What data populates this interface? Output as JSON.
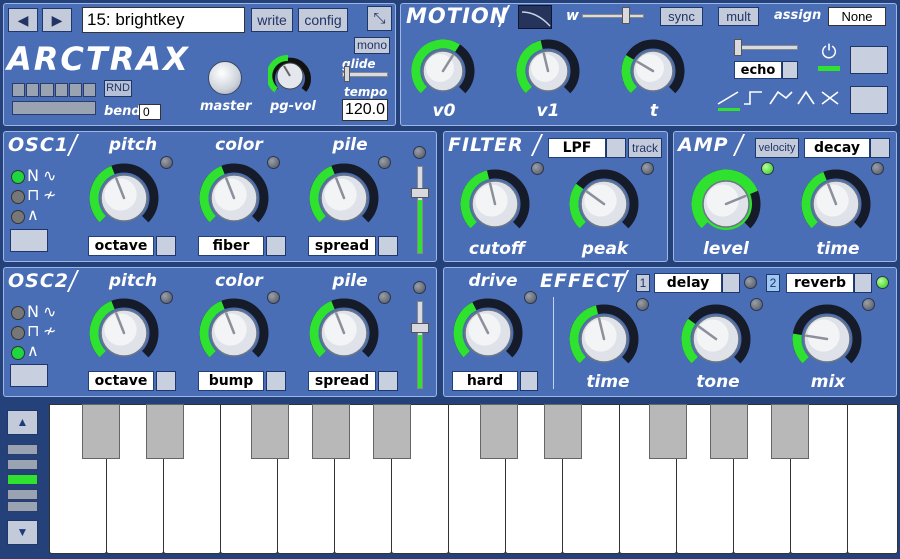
{
  "header": {
    "prev_label": "◀",
    "next_label": "▶",
    "preset_value": "15: brightkey",
    "write_label": "write",
    "config_label": "config",
    "collapse_icon": "collapse-icon",
    "logo": "ARCTRAX",
    "mono_label": "mono",
    "rnd_label": "RND",
    "bend_label": "bend",
    "bend_value": "0",
    "master_label": "master",
    "pgvol_label": "pg-vol",
    "glide_label": "glide",
    "tempo_label": "tempo",
    "tempo_value": "120.0"
  },
  "motion": {
    "title": "MOTION",
    "w_label": "w",
    "sync_label": "sync",
    "mult_label": "mult",
    "assign_label": "assign",
    "assign_value": "None",
    "knobs": [
      {
        "label": "v0",
        "value": 0.62
      },
      {
        "label": "v1",
        "value": 0.45
      },
      {
        "label": "t",
        "value": 0.28
      }
    ],
    "echo_label": "echo",
    "power_icon": "power-icon"
  },
  "osc1": {
    "title": "OSC1",
    "knobs": [
      {
        "label": "pitch",
        "sub": "octave",
        "value": 0.42
      },
      {
        "label": "color",
        "sub": "fiber",
        "value": 0.42
      },
      {
        "label": "pile",
        "sub": "spread",
        "value": 0.42
      }
    ]
  },
  "osc2": {
    "title": "OSC2",
    "knobs": [
      {
        "label": "pitch",
        "sub": "octave",
        "value": 0.42
      },
      {
        "label": "color",
        "sub": "bump",
        "value": 0.42
      },
      {
        "label": "pile",
        "sub": "spread",
        "value": 0.42
      }
    ]
  },
  "filter": {
    "title": "FILTER",
    "type_value": "LPF",
    "track_label": "track",
    "knobs": [
      {
        "label": "cutoff",
        "value": 0.45
      },
      {
        "label": "peak",
        "value": 0.3
      }
    ]
  },
  "amp": {
    "title": "AMP",
    "velocity_label": "velocity",
    "env_value": "decay",
    "knobs": [
      {
        "label": "level",
        "value": 0.75
      },
      {
        "label": "time",
        "value": 0.42
      }
    ]
  },
  "effect": {
    "title": "EFFECT",
    "drive_label": "drive",
    "drive_sub": "hard",
    "drive_value": 0.4,
    "slot1_num": "1",
    "slot1_value": "delay",
    "slot2_num": "2",
    "slot2_value": "reverb",
    "knobs": [
      {
        "label": "time",
        "value": 0.45
      },
      {
        "label": "tone",
        "value": 0.3
      },
      {
        "label": "mix",
        "value": 0.2
      }
    ]
  },
  "colors": {
    "accent": "#2fe22f",
    "panel": "#4a6eb5",
    "background": "#24417a"
  }
}
